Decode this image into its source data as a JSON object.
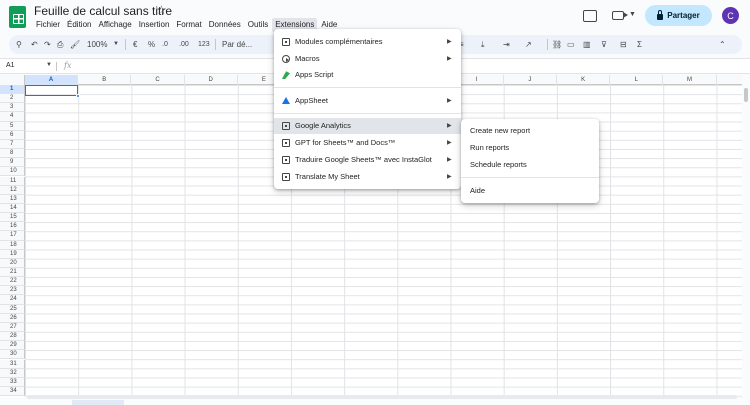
{
  "app": {
    "title": "Feuille de calcul sans titre",
    "menus": [
      "Fichier",
      "Édition",
      "Affichage",
      "Insertion",
      "Format",
      "Données",
      "Outils",
      "Extensions",
      "Aide"
    ],
    "active_menu": "Extensions",
    "share_label": "Partager",
    "avatar_initial": "C",
    "accent_color": "#0f9d58"
  },
  "toolbar": {
    "zoom": "100%",
    "currency": "€",
    "percent": "%",
    "decimal_decrease": ".0",
    "decimal_increase": ".00",
    "number_format": "123",
    "font_default": "Par dé..."
  },
  "formula_bar": {
    "cell_ref": "A1",
    "fx": "fx",
    "value": ""
  },
  "grid": {
    "columns": [
      "A",
      "B",
      "C",
      "D",
      "E",
      "F",
      "G",
      "H",
      "I",
      "J",
      "K",
      "L",
      "M"
    ],
    "rows": [
      "1",
      "2",
      "3",
      "4",
      "5",
      "6",
      "7",
      "8",
      "9",
      "10",
      "11",
      "12",
      "13",
      "14",
      "15",
      "16",
      "17",
      "18",
      "19",
      "20",
      "21",
      "22",
      "23",
      "24",
      "25",
      "26",
      "27",
      "28",
      "29",
      "30",
      "31",
      "32",
      "33",
      "34"
    ],
    "selected_cell": "A1"
  },
  "extensions_menu": {
    "items": [
      {
        "label": "Modules complémentaires",
        "icon": "addon-icon",
        "submenu": true
      },
      {
        "label": "Macros",
        "icon": "macro-play-icon",
        "submenu": true
      },
      {
        "label": "Apps Script",
        "icon": "apps-script-icon",
        "submenu": false
      },
      {
        "label": "AppSheet",
        "icon": "appsheet-icon",
        "submenu": true
      },
      {
        "label": "Google Analytics",
        "icon": "addon-icon",
        "submenu": true
      },
      {
        "label": "GPT for Sheets™ and Docs™",
        "icon": "addon-icon",
        "submenu": true
      },
      {
        "label": "Traduire Google Sheets™ avec InstaGlot",
        "icon": "addon-icon",
        "submenu": true
      },
      {
        "label": "Translate My Sheet",
        "icon": "addon-icon",
        "submenu": true
      }
    ],
    "highlighted": "Google Analytics"
  },
  "google_analytics_submenu": {
    "items": [
      "Create new report",
      "Run reports",
      "Schedule reports",
      "Aide"
    ]
  }
}
